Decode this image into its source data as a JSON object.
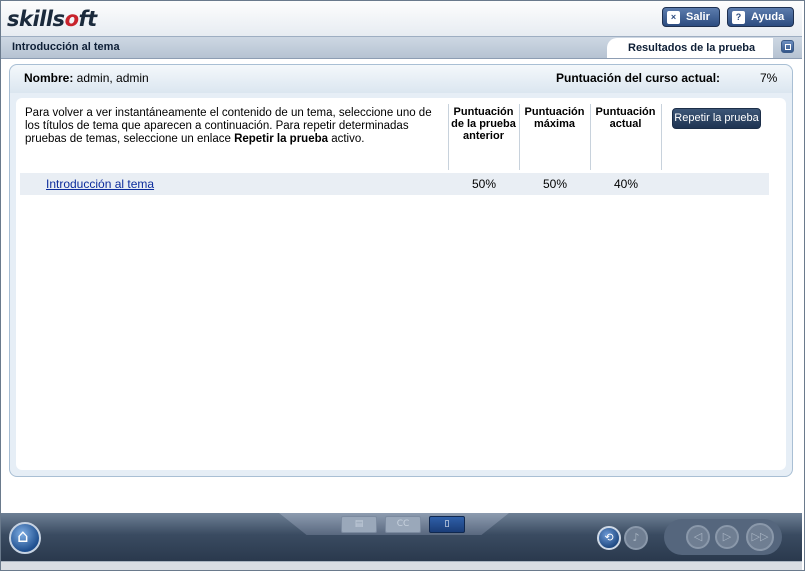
{
  "app": {
    "logo_text_a": "skills",
    "logo_text_ring": "o",
    "logo_text_b": "ft"
  },
  "header": {
    "exit_label": "Salir",
    "help_label": "Ayuda",
    "exit_icon": "close-icon",
    "help_icon": "question-icon"
  },
  "titlebar": {
    "title": "Introducción al tema",
    "active_tab": "Resultados de la prueba"
  },
  "summary": {
    "name_label": "Nombre:",
    "name_value": " admin, admin",
    "course_score_label": "Puntuación del curso actual:",
    "course_score_value": "7%"
  },
  "results": {
    "intro_text_1": "Para volver a ver instantáneamente el contenido de un tema, seleccione uno de los títulos de tema que aparecen a continuación. Para repetir determinadas pruebas de temas, seleccione un enlace ",
    "intro_bold": "Repetir la prueba",
    "intro_text_2": " activo.",
    "columns": [
      {
        "line1": "Puntuación",
        "line2": "de la prueba",
        "line3": "anterior"
      },
      {
        "line1": "Puntuación",
        "line2": "máxima",
        "line3": ""
      },
      {
        "line1": "Puntuación",
        "line2": "actual",
        "line3": ""
      }
    ],
    "retry_label": "Repetir la prueba",
    "rows": [
      {
        "topic": "Introducción al tema",
        "previous": "50%",
        "max": "50%",
        "current": "40%"
      }
    ]
  },
  "footer": {
    "home_icon": "home-icon",
    "tabs": [
      {
        "icon": "list-icon",
        "glyph": "▤",
        "active": false
      },
      {
        "icon": "captions-icon",
        "glyph": "CC",
        "active": false
      },
      {
        "icon": "document-icon",
        "glyph": "▯",
        "active": true
      }
    ],
    "replay_icon": "replay-icon",
    "audio_icon": "audio-icon",
    "nav": {
      "prev_glyph": "◁",
      "play_glyph": "▷",
      "next_glyph": "▷▷"
    }
  },
  "colors": {
    "accent": "#2c4c80",
    "link": "#0c2c9c",
    "panel": "#e6eef6",
    "row": "#e9eef4"
  }
}
